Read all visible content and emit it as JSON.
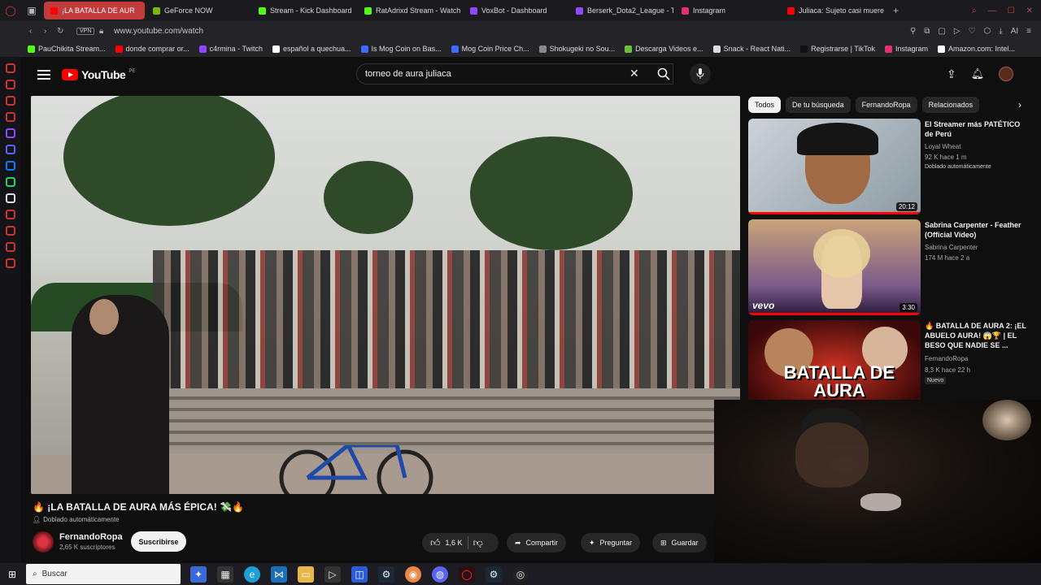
{
  "browser": {
    "tabs": [
      {
        "label": "¡LA BATALLA DE AUR",
        "color": "#ff0000",
        "active": true
      },
      {
        "label": "GeForce NOW",
        "color": "#76b900"
      },
      {
        "label": "Stream - Kick Dashboard",
        "color": "#53fc18"
      },
      {
        "label": "RatAdrixd Stream - Watch",
        "color": "#53fc18"
      },
      {
        "label": "VoxBot - Dashboard",
        "color": "#9146ff"
      },
      {
        "label": "Berserk_Dota2_League - T",
        "color": "#9146ff"
      },
      {
        "label": "Instagram",
        "color": "#e1306c"
      },
      {
        "label": "Juliaca: Sujeto casi muere",
        "color": "#ff0000"
      }
    ],
    "new_tab": "+",
    "url": "www.youtube.com/watch",
    "vpn": "VPN",
    "bookmarks": [
      {
        "label": "PauChikita Stream...",
        "color": "#53fc18"
      },
      {
        "label": "donde comprar or...",
        "color": "#ff0000"
      },
      {
        "label": "c4rmina - Twitch",
        "color": "#9146ff"
      },
      {
        "label": "español a quechua...",
        "color": "#ffffff"
      },
      {
        "label": "Is Mog Coin on Bas...",
        "color": "#3b6cff"
      },
      {
        "label": "Mog Coin Price Ch...",
        "color": "#3b6cff"
      },
      {
        "label": "Shokugeki no Sou...",
        "color": "#888888"
      },
      {
        "label": "Descarga Videos e...",
        "color": "#6ac03c"
      },
      {
        "label": "Snack - React Nati...",
        "color": "#dddddd"
      },
      {
        "label": "Registrarse | TikTok",
        "color": "#111111"
      },
      {
        "label": "Instagram",
        "color": "#e1306c"
      },
      {
        "label": "Amazon.com: Intel...",
        "color": "#ffffff"
      }
    ]
  },
  "youtube": {
    "logo": "YouTube",
    "country": "PE",
    "search_query": "torneo de aura juliaca",
    "video": {
      "title": "🔥 ¡LA BATALLA DE AURA MÁS ÉPICA! 💸🔥",
      "dub_note": "Doblado automáticamente",
      "channel": "FernandoRopa",
      "subscribers": "2,65 K suscriptores",
      "subscribe_label": "Suscribirse",
      "likes": "1,6 K",
      "share_label": "Compartir",
      "ask_label": "Preguntar",
      "save_label": "Guardar"
    },
    "chips": [
      "Todos",
      "De tu búsqueda",
      "FernandoRopa",
      "Relacionados"
    ],
    "recommendations": [
      {
        "title": "El Streamer más PATÉTICO de Perú",
        "channel": "Loyal Wheat",
        "meta": "92 K  hace 1 m",
        "badge": "Doblado automáticamente",
        "duration": "20:12"
      },
      {
        "title": "Sabrina Carpenter - Feather (Official Video)",
        "channel": "Sabrina Carpenter",
        "meta": "174 M  hace 2 a",
        "duration": "3:30",
        "brand": "vevo"
      },
      {
        "title": "🔥 BATALLA DE AURA 2: ¡EL ABUELO AURA! 😱🏆 | EL BESO QUE NADIE SE ...",
        "channel": "FernandoRopa",
        "meta": "8,3 K  hace 22 h",
        "badge": "Nuevo",
        "thumb_text": "BATALLA DE AURA"
      }
    ]
  },
  "taskbar": {
    "search_placeholder": "Buscar"
  }
}
